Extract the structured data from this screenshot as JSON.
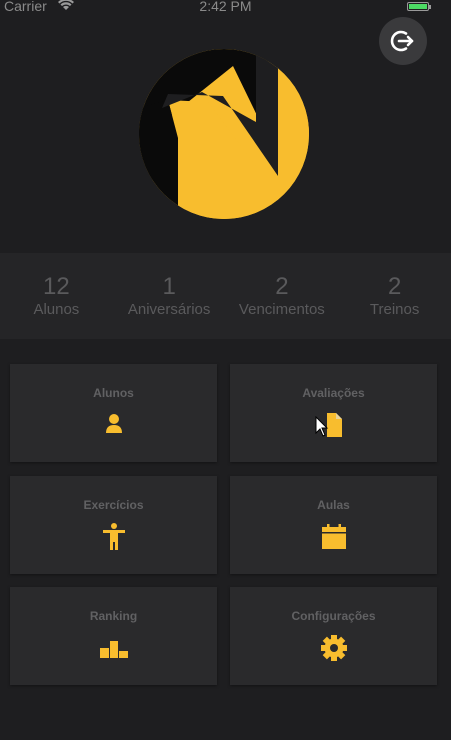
{
  "status_bar": {
    "carrier": "Carrier",
    "time": "2:42 PM",
    "battery_color": "#4cd964"
  },
  "colors": {
    "accent": "#f8bd2e",
    "background": "#1e1e20",
    "tile": "#2a2a2c",
    "stats_bg": "#252527"
  },
  "header": {
    "logout_icon": "logout-icon",
    "logo": "brand-logo"
  },
  "stats": [
    {
      "value": "12",
      "label": "Alunos"
    },
    {
      "value": "1",
      "label": "Aniversários"
    },
    {
      "value": "2",
      "label": "Vencimentos"
    },
    {
      "value": "2",
      "label": "Treinos"
    }
  ],
  "menu": [
    {
      "label": "Alunos",
      "icon": "person-icon"
    },
    {
      "label": "Avaliações",
      "icon": "document-icon"
    },
    {
      "label": "Exercícios",
      "icon": "accessibility-icon"
    },
    {
      "label": "Aulas",
      "icon": "calendar-icon"
    },
    {
      "label": "Ranking",
      "icon": "podium-icon"
    },
    {
      "label": "Configurações",
      "icon": "gear-icon"
    }
  ]
}
